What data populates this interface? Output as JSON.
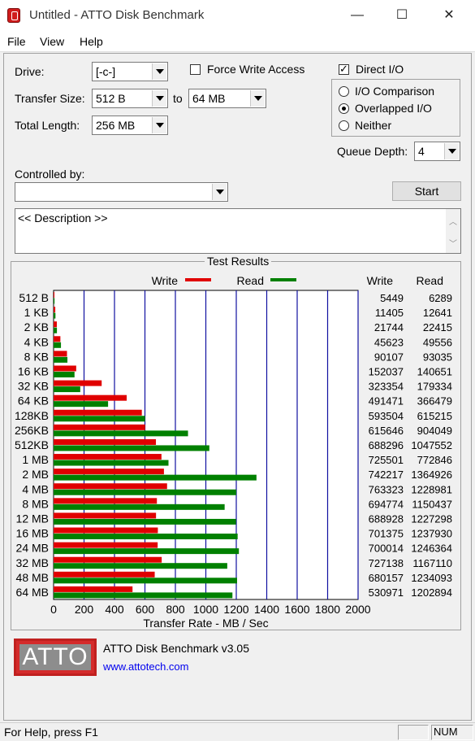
{
  "window": {
    "title": "Untitled - ATTO Disk Benchmark",
    "minimize": "—",
    "maximize": "☐",
    "close": "✕"
  },
  "menu": [
    "File",
    "View",
    "Help"
  ],
  "settings": {
    "drive_label": "Drive:",
    "drive_value": "[-c-]",
    "transfer_size_label": "Transfer Size:",
    "transfer_from": "512 B",
    "to_label": "to",
    "transfer_to": "64 MB",
    "total_length_label": "Total Length:",
    "total_length_value": "256 MB",
    "force_write_label": "Force Write Access",
    "force_write_checked": false,
    "direct_io_label": "Direct I/O",
    "direct_io_checked": true,
    "io_options": [
      {
        "label": "I/O Comparison",
        "checked": false
      },
      {
        "label": "Overlapped I/O",
        "checked": true
      },
      {
        "label": "Neither",
        "checked": false
      }
    ],
    "queue_depth_label": "Queue Depth:",
    "queue_depth_value": "4",
    "controlled_by_label": "Controlled by:",
    "controlled_by_value": "",
    "start_button": "Start",
    "description": "<< Description >>"
  },
  "colors": {
    "write": "#e00000",
    "read": "#008000",
    "grid": "#1010a0"
  },
  "chart_data": {
    "type": "bar",
    "title": "Test Results",
    "xlabel": "Transfer Rate - MB / Sec",
    "ylabel": "",
    "xlim": [
      0,
      2000
    ],
    "xticks": [
      "0",
      "200",
      "400",
      "600",
      "800",
      "1000",
      "1200",
      "1400",
      "1600",
      "1800",
      "2000"
    ],
    "categories": [
      "512 B",
      "1 KB",
      "2 KB",
      "4 KB",
      "8 KB",
      "16 KB",
      "32 KB",
      "64 KB",
      "128KB",
      "256KB",
      "512KB",
      "1 MB",
      "2 MB",
      "4 MB",
      "8 MB",
      "12 MB",
      "16 MB",
      "24 MB",
      "32 MB",
      "48 MB",
      "64 MB"
    ],
    "legend": {
      "write": "Write",
      "read": "Read"
    },
    "column_headers": {
      "write": "Write",
      "read": "Read"
    },
    "series": [
      {
        "name": "Write",
        "values_mb": [
          5.3,
          11.1,
          21.2,
          44.6,
          88.0,
          148.5,
          315.8,
          480.0,
          579.6,
          601.2,
          672.2,
          708.5,
          724.8,
          745.4,
          678.5,
          672.8,
          684.9,
          683.6,
          710.1,
          664.2,
          518.5
        ],
        "values": [
          "5449",
          "11405",
          "21744",
          "45623",
          "90107",
          "152037",
          "323354",
          "491471",
          "593504",
          "615646",
          "688296",
          "725501",
          "742217",
          "763323",
          "694774",
          "688928",
          "701375",
          "700014",
          "727138",
          "680157",
          "530971"
        ]
      },
      {
        "name": "Read",
        "values_mb": [
          6.1,
          12.3,
          21.9,
          48.4,
          90.9,
          137.4,
          175.1,
          357.9,
          600.8,
          882.9,
          1023.0,
          754.7,
          1332.6,
          1200.2,
          1123.5,
          1198.5,
          1208.9,
          1217.1,
          1140.7,
          1205.2,
          1174.7
        ],
        "values": [
          "6289",
          "12641",
          "22415",
          "49556",
          "93035",
          "140651",
          "179334",
          "366479",
          "615215",
          "904049",
          "1047552",
          "772846",
          "1364926",
          "1228981",
          "1150437",
          "1227298",
          "1237930",
          "1246364",
          "1167110",
          "1234093",
          "1202894"
        ]
      }
    ]
  },
  "about": {
    "logo_text": "ATTO",
    "product": "ATTO Disk Benchmark v3.05",
    "link": "www.attotech.com"
  },
  "status": {
    "message": "For Help, press F1",
    "num": "NUM"
  }
}
